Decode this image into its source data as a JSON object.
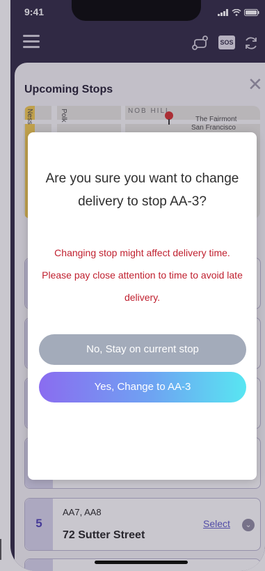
{
  "status_bar": {
    "time": "9:41",
    "icons": [
      "signal-icon",
      "wifi-icon",
      "battery-icon"
    ]
  },
  "app_bar": {
    "menu_icon": "hamburger-menu-icon",
    "route_icon": "route-icon",
    "sos_label": "SOS",
    "refresh_icon": "refresh-icon"
  },
  "sheet": {
    "title": "Upcoming Stops",
    "close_icon": "close-icon",
    "map": {
      "labels": {
        "district": "NOB HILL",
        "hotel_line1": "The Fairmont",
        "hotel_line2": "San Francisco",
        "street_left": "Ness",
        "street_polk": "Polk"
      },
      "pin_icon": "map-pin-icon"
    },
    "stops": [
      {
        "number": "5",
        "ids": "AA7, AA8",
        "address": "72 Sutter Street",
        "select_label": "Select"
      }
    ]
  },
  "modal": {
    "question": "Are you sure you want to change delivery to stop AA-3?",
    "warning": "Changing stop might affect delivery time. Please pay close attention to time to avoid late delivery.",
    "stay_label": "No, Stay on current stop",
    "change_label": "Yes, Change to AA-3"
  },
  "colors": {
    "header_bg": "#2b2540",
    "warning_text": "#c0202f",
    "stay_button": "#a3abba",
    "change_gradient_start": "#8a6cf0",
    "change_gradient_end": "#58e6f2",
    "select_link": "#5a55c9"
  }
}
